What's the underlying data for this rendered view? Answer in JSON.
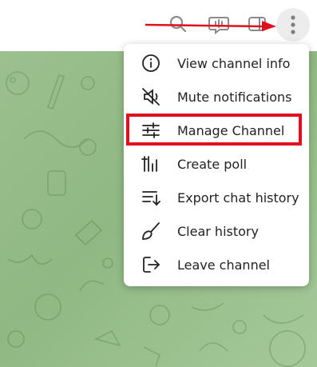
{
  "colors": {
    "accent_arrow": "#e0101c",
    "highlight": "#e0101c",
    "chat_background": "#9cc08f",
    "menu_text": "#222222",
    "icon_gray": "#7f7f7f"
  },
  "header": {
    "icons": [
      "search-icon",
      "voice-chat-icon",
      "sidebar-toggle-icon",
      "more-vertical-icon"
    ]
  },
  "menu": {
    "items": [
      {
        "label": "View channel info",
        "icon": "info-icon"
      },
      {
        "label": "Mute notifications",
        "icon": "mute-icon"
      },
      {
        "label": "Manage Channel",
        "icon": "sliders-icon",
        "highlighted": true
      },
      {
        "label": "Create poll",
        "icon": "poll-icon"
      },
      {
        "label": "Export chat history",
        "icon": "export-icon"
      },
      {
        "label": "Clear history",
        "icon": "broom-icon"
      },
      {
        "label": "Leave channel",
        "icon": "leave-icon"
      }
    ]
  }
}
